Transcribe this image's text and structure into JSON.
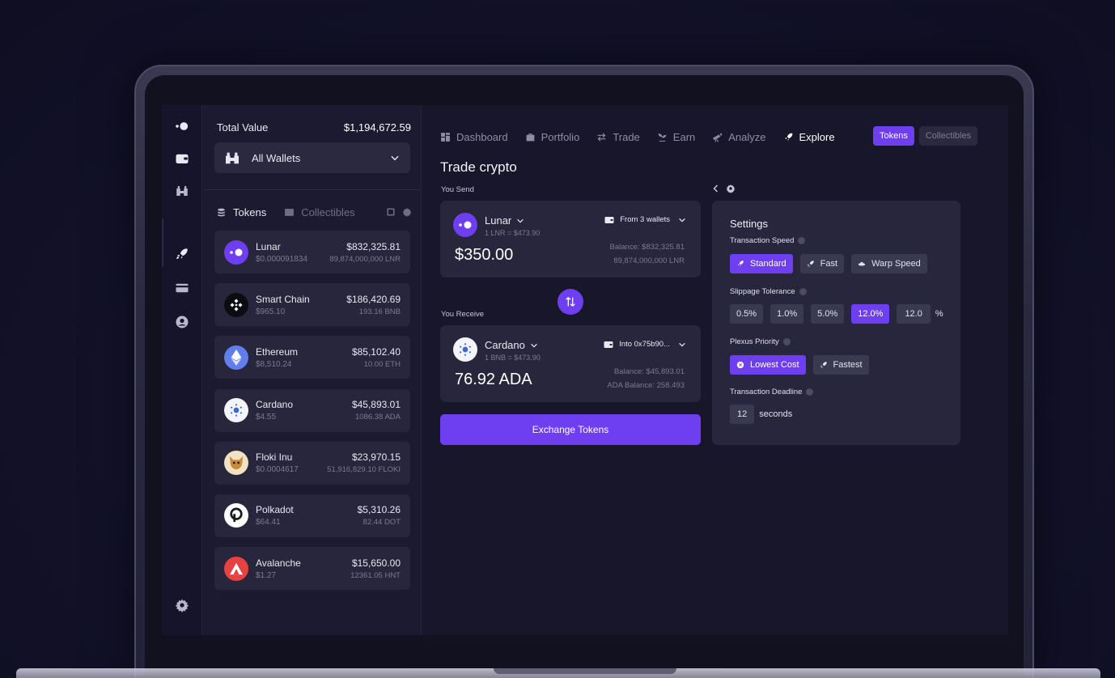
{
  "colors": {
    "accent": "#6e3ff0",
    "bg": "#17162a",
    "card": "#27263c"
  },
  "sidebar": {
    "total_value_label": "Total Value",
    "total_value": "$1,194,672.59",
    "wallet_select": "All Wallets",
    "tabs": {
      "tokens": "Tokens",
      "collectibles": "Collectibles"
    },
    "tokens": [
      {
        "name": "Lunar",
        "price": "$0.000091834",
        "value": "$832,325.81",
        "amount": "89,874,000,000 LNR"
      },
      {
        "name": "Smart Chain",
        "price": "$965.10",
        "value": "$186,420.69",
        "amount": "193.16 BNB"
      },
      {
        "name": "Ethereum",
        "price": "$8,510.24",
        "value": "$85,102.40",
        "amount": "10.00 ETH"
      },
      {
        "name": "Cardano",
        "price": "$4.55",
        "value": "$45,893.01",
        "amount": "1086.38 ADA"
      },
      {
        "name": "Floki Inu",
        "price": "$0.0004617",
        "value": "$23,970.15",
        "amount": "51,916,829.10 FLOKI"
      },
      {
        "name": "Polkadot",
        "price": "$64.41",
        "value": "$5,310.26",
        "amount": "82.44 DOT"
      },
      {
        "name": "Avalanche",
        "price": "$1.27",
        "value": "$15,650.00",
        "amount": "12361.05 HNT"
      }
    ]
  },
  "nav": {
    "items": [
      "Dashboard",
      "Portfolio",
      "Trade",
      "Earn",
      "Analyze",
      "Explore"
    ],
    "toggle": {
      "tokens": "Tokens",
      "collectibles": "Collectibles"
    }
  },
  "trade": {
    "title": "Trade crypto",
    "send_label": "You Send",
    "receive_label": "You Receive",
    "send": {
      "coin": "Lunar",
      "rate": "1 LNR = $473.90",
      "wallet": "From 3 wallets",
      "amount": "$350.00",
      "balance": "Balance: $832,325.81",
      "balance2": "89,874,000,000 LNR"
    },
    "receive": {
      "coin": "Cardano",
      "rate": "1 BNB = $473.90",
      "wallet": "Into 0x75b90...",
      "amount": "76.92 ADA",
      "balance": "Balance: $45,893.01",
      "balance2": "ADA Balance: 258.493"
    },
    "exchange_button": "Exchange Tokens"
  },
  "settings": {
    "title": "Settings",
    "speed_label": "Transaction Speed",
    "speed_options": [
      "Standard",
      "Fast",
      "Warp Speed"
    ],
    "slippage_label": "Slippage Tolerance",
    "slippage_options": [
      "0.5%",
      "1.0%",
      "5.0%",
      "12.0%"
    ],
    "slippage_custom": "12.0",
    "slippage_unit": "%",
    "priority_label": "Plexus Priority",
    "priority_options": [
      "Lowest Cost",
      "Fastest"
    ],
    "deadline_label": "Transaction Deadline",
    "deadline_value": "12",
    "deadline_unit": "seconds"
  }
}
